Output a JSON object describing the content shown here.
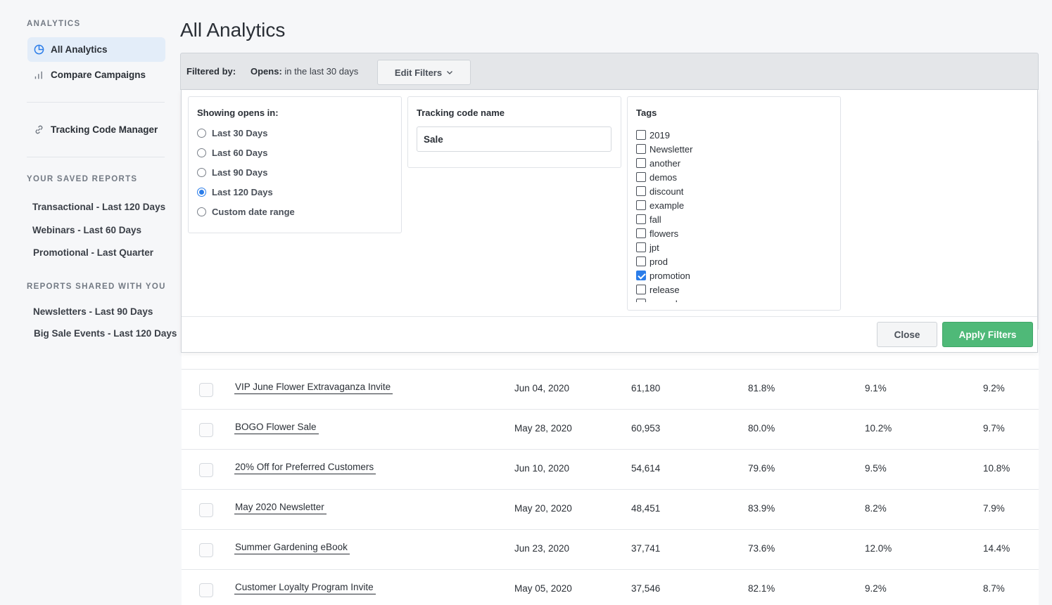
{
  "sidebar": {
    "analytics_heading": "ANALYTICS",
    "nav": [
      {
        "label": "All Analytics",
        "icon": "pie-chart-icon",
        "active": true
      },
      {
        "label": "Compare Campaigns",
        "icon": "bar-chart-icon",
        "active": false
      }
    ],
    "tracking_link": {
      "label": "Tracking Code Manager",
      "icon": "link-icon"
    },
    "saved_heading": "YOUR SAVED REPORTS",
    "saved_reports": [
      "Transactional - Last 120 Days",
      "Webinars - Last 60 Days",
      "Promotional - Last Quarter"
    ],
    "shared_heading": "REPORTS SHARED WITH YOU",
    "shared_reports": [
      "Newsletters - Last 90 Days",
      "Big Sale Events - Last 120 Days"
    ]
  },
  "main": {
    "title": "All Analytics",
    "filter_bar": {
      "label": "Filtered by:",
      "opens_key": "Opens:",
      "opens_value": "in the last 30 days",
      "edit_button": "Edit Filters",
      "edit_icon": "chevron-down-icon"
    },
    "filter_panel": {
      "opens_card": {
        "heading": "Showing opens in:",
        "options": [
          "Last 30 Days",
          "Last 60 Days",
          "Last 90 Days",
          "Last 120 Days",
          "Custom date range"
        ],
        "selected": "Last 120 Days"
      },
      "tracking_card": {
        "heading": "Tracking code name",
        "value": "Sale"
      },
      "tags_card": {
        "heading": "Tags",
        "tags": [
          "2019",
          "Newsletter",
          "another",
          "demos",
          "discount",
          "example",
          "fall",
          "flowers",
          "jpt",
          "prod",
          "promotion",
          "release",
          "resend"
        ],
        "checked": [
          "promotion"
        ]
      },
      "close_button": "Close",
      "apply_button": "Apply Filters",
      "apply_color": "#4fb978",
      "accent_color": "#2b7de9"
    },
    "table": {
      "rows": [
        {
          "name": "VIP June Flower Extravaganza Invite",
          "date": "Jun 04, 2020",
          "sent": "61,180",
          "c1": "81.8%",
          "c2": "9.1%",
          "c3": "9.2%"
        },
        {
          "name": "BOGO Flower Sale",
          "date": "May 28, 2020",
          "sent": "60,953",
          "c1": "80.0%",
          "c2": "10.2%",
          "c3": "9.7%"
        },
        {
          "name": "20% Off for Preferred Customers",
          "date": "Jun 10, 2020",
          "sent": "54,614",
          "c1": "79.6%",
          "c2": "9.5%",
          "c3": "10.8%"
        },
        {
          "name": "May 2020 Newsletter",
          "date": "May 20, 2020",
          "sent": "48,451",
          "c1": "83.9%",
          "c2": "8.2%",
          "c3": "7.9%"
        },
        {
          "name": "Summer Gardening eBook",
          "date": "Jun 23, 2020",
          "sent": "37,741",
          "c1": "73.6%",
          "c2": "12.0%",
          "c3": "14.4%"
        },
        {
          "name": "Customer Loyalty Program Invite",
          "date": "May 05, 2020",
          "sent": "37,546",
          "c1": "82.1%",
          "c2": "9.2%",
          "c3": "8.7%"
        }
      ]
    }
  }
}
